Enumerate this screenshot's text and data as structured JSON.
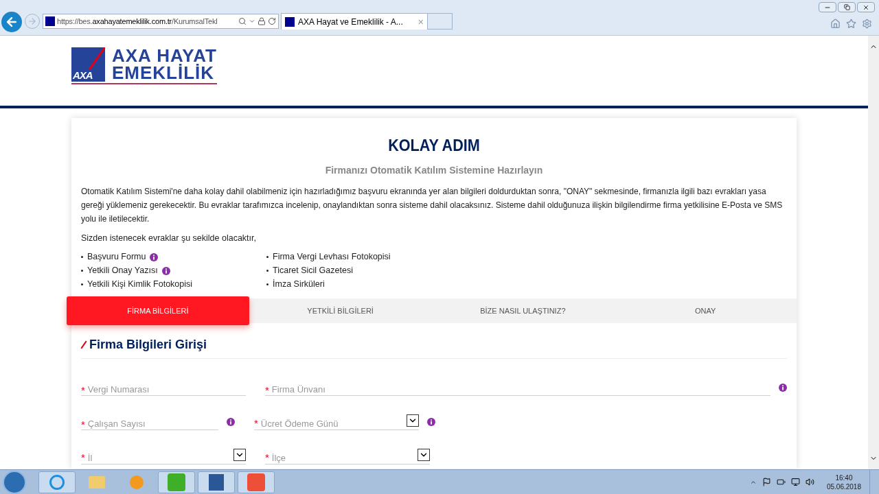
{
  "browser": {
    "address_prefix": "https://bes.",
    "address_domain": "axahayatemeklilik.com.tr",
    "address_path": "/KurumsalTekl",
    "tab_title": "AXA Hayat ve Emeklilik - A...",
    "tab_close": "×"
  },
  "logo": {
    "mark": "AXA",
    "line1": "AXA HAYAT",
    "line2": "EMEKLİLİK"
  },
  "card": {
    "title": "KOLAY ADIM",
    "subtitle": "Firmanızı Otomatik Katılım Sistemine Hazırlayın",
    "intro": "Otomatik Katılım Sistemi'ne daha kolay dahil olabilmeniz için hazırladığımız başvuru ekranında yer alan bilgileri doldurduktan sonra, \"ONAY\" sekmesinde, firmanızla ilgili bazı evrakları yasa gereği yüklemeniz gerekecektir. Bu evraklar tarafımızca incelenip, onaylandıktan sonra sisteme dahil olacaksınız. Sisteme dahil olduğunuza ilişkin bilgilendirme firma yetkilisine E-Posta ve SMS yolu ile iletilecektir.",
    "list_intro": "Sizden istenecek evraklar şu sekilde olacaktır,",
    "document_columns": [
      {
        "items": [
          {
            "label": "Başvuru Formu",
            "info": true
          },
          {
            "label": "Yetkili Onay Yazısı",
            "info": true
          },
          {
            "label": "Yetkili Kişi Kimlik Fotokopisi",
            "info": false
          }
        ]
      },
      {
        "items": [
          {
            "label": "Firma Vergi Levhası Fotokopisi",
            "info": false
          },
          {
            "label": "Ticaret Sicil Gazetesi",
            "info": false
          },
          {
            "label": "İmza Sirküleri",
            "info": false
          }
        ]
      }
    ],
    "tabs": [
      {
        "label": "FİRMA BİLGİLERİ",
        "selected": true
      },
      {
        "label": "YETKİLİ BİLGİLERİ",
        "selected": false
      },
      {
        "label": "BİZE NASIL ULAŞTINIZ?",
        "selected": false
      },
      {
        "label": "ONAY",
        "selected": false
      }
    ],
    "section_title": "Firma Bilgileri Girişi",
    "field_rows": [
      [
        {
          "kind": "text",
          "placeholder": "Vergi Numarası",
          "required_mark": "*",
          "info": false
        },
        {
          "kind": "text",
          "placeholder": "Firma Ünvanı",
          "required_mark": "*",
          "info": true
        }
      ],
      [
        {
          "kind": "text",
          "placeholder": "Çalışan Sayısı",
          "required_mark": "*",
          "info": true
        },
        {
          "kind": "select",
          "placeholder": "Ücret Ödeme Günü",
          "required_mark": "*",
          "info": true
        }
      ],
      [
        {
          "kind": "select",
          "placeholder": "İl",
          "required_mark": "*",
          "info": false
        },
        {
          "kind": "select",
          "placeholder": "İlçe",
          "required_mark": "*",
          "info": false
        }
      ]
    ]
  },
  "taskbar": {
    "time": "16:40",
    "date": "05.06.2018"
  }
}
